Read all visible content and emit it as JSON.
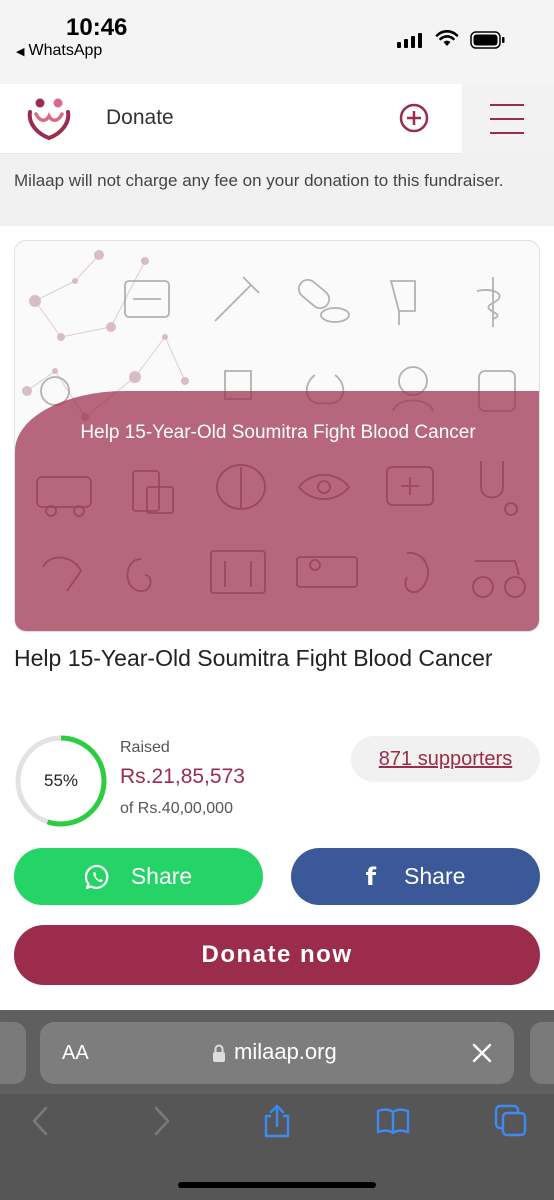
{
  "status_bar": {
    "time": "10:46",
    "back_app": "WhatsApp"
  },
  "header": {
    "title": "Donate",
    "brand_color": "#9b2c4c"
  },
  "notice": {
    "text": "Milaap will not charge any fee on your donation to this fundraiser."
  },
  "hero": {
    "overlay_title": "Help 15-Year-Old Soumitra Fight Blood Cancer"
  },
  "campaign": {
    "title": "Help 15-Year-Old Soumitra Fight Blood Cancer",
    "progress_label": "55%",
    "progress_fraction": 0.55,
    "raised_label": "Raised",
    "raised_amount": "Rs.21,85,573",
    "goal_text": "of Rs.40,00,000",
    "supporters": "871 supporters"
  },
  "actions": {
    "whatsapp_share": "Share",
    "facebook_share": "Share",
    "donate_now": "Donate now"
  },
  "browser": {
    "aa_label": "AA",
    "url": "milaap.org"
  },
  "colors": {
    "brand": "#9b2c4c",
    "whatsapp": "#25d366",
    "facebook": "#3b5998",
    "progress": "#2ecc40"
  }
}
